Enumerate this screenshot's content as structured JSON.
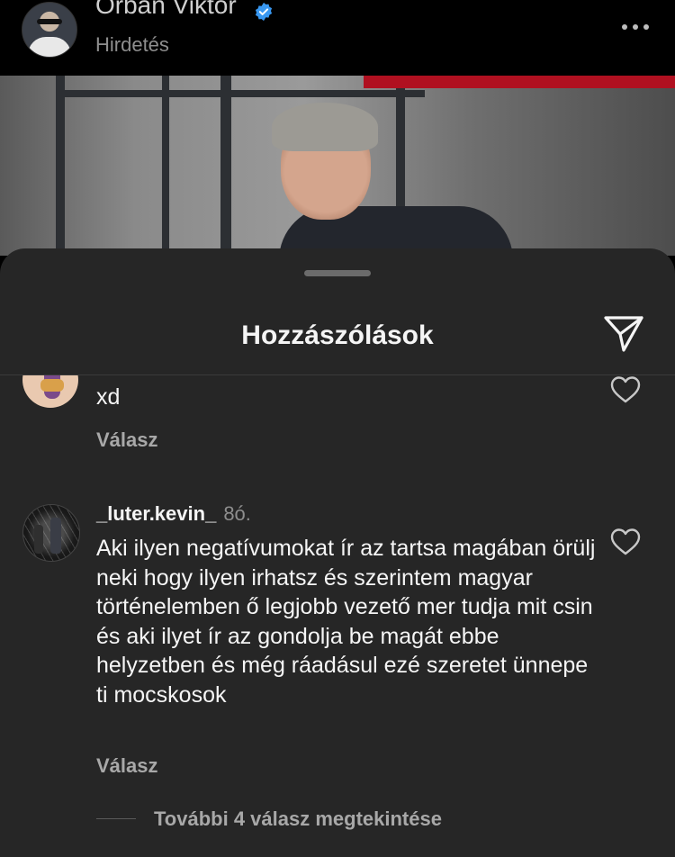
{
  "post": {
    "account_name": "Orbán Viktor",
    "sponsored_label": "Hirdetés",
    "icons": {
      "verified": "verified-badge-icon",
      "more": "more-options-icon"
    }
  },
  "comments_sheet": {
    "title": "Hozzászólások",
    "icons": {
      "share": "paper-plane-icon"
    },
    "comments": [
      {
        "username": "",
        "time": "",
        "text": "xd",
        "reply_label": "Válasz"
      },
      {
        "username": "_luter.kevin_",
        "time": "8ó.",
        "text": "Aki ilyen negatívumokat ír az tartsa magában örülj neki hogy ilyen irhatsz és szerintem magyar történelemben ő legjobb vezető mer tudja mit csin és aki ilyet ír az gondolja be magát ebbe helyzetben és még ráadásul ezé szeretet ünnepe ti mocskosok",
        "reply_label": "Válasz"
      }
    ],
    "view_more_replies": "További 4 válasz megtekintése"
  },
  "colors": {
    "sheet_background": "#262626",
    "page_background": "#000000",
    "primary_text": "#f5f5f5",
    "secondary_text": "#a8a8a8",
    "verified_blue": "#3897f0",
    "accent_red": "#b01020"
  }
}
